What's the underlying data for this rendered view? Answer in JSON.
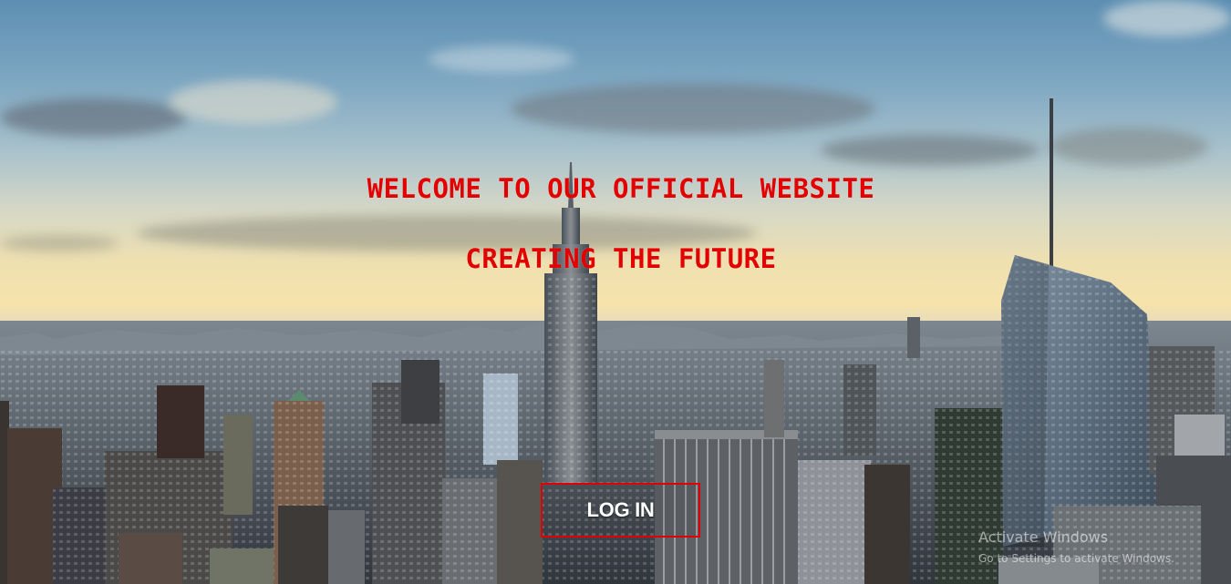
{
  "hero": {
    "title": "WELCOME TO OUR OFFICIAL WEBSITE",
    "subtitle": "CREATING THE FUTURE"
  },
  "login": {
    "label": "LOG IN"
  },
  "watermark": {
    "title": "Activate Windows",
    "subtitle": "Go to Settings to activate Windows."
  },
  "colors": {
    "headline": "#e30000",
    "button_border": "#e00000",
    "button_text": "#ffffff"
  },
  "background": {
    "scene": "city-skyline-photo"
  }
}
